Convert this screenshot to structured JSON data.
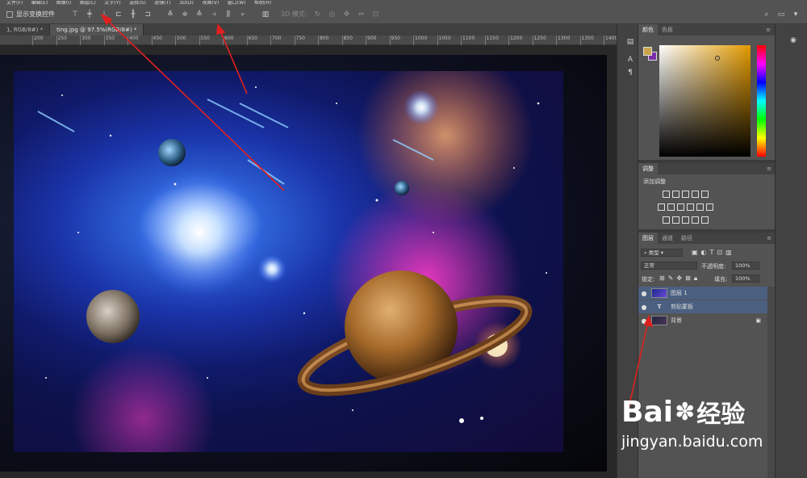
{
  "menubar": {
    "items": [
      "文件(F)",
      "编辑(E)",
      "图像(I)",
      "图层(L)",
      "文字(Y)",
      "选择(S)",
      "滤镜(T)",
      "3D(D)",
      "视图(V)",
      "窗口(W)",
      "帮助(H)"
    ]
  },
  "options": {
    "show_transform_label": "显示变换控件",
    "mode_3d_label": "3D 模式:"
  },
  "tabs": [
    {
      "label": "1, RGB/8#) *",
      "active": false
    },
    {
      "label": "ting.jpg @ 97.5%(RGB/8#) *",
      "active": true
    }
  ],
  "ruler": {
    "ticks": [
      "200",
      "250",
      "300",
      "350",
      "400",
      "450",
      "500",
      "550",
      "600",
      "650",
      "700",
      "750",
      "800",
      "850",
      "900",
      "950",
      "1000",
      "1050",
      "1100",
      "1150",
      "1200",
      "1250",
      "1300",
      "1350",
      "1400"
    ]
  },
  "color_panel": {
    "tab_active": "颜色",
    "tab_other": "色板",
    "foreground": "#c9a44a",
    "background": "#7b2fa8"
  },
  "adjust_panel": {
    "title": "调整",
    "add_label": "添加调整"
  },
  "layers_panel": {
    "tabs": [
      "图层",
      "通道",
      "路径"
    ],
    "filter_label": "类型",
    "blend_mode": "正常",
    "opacity_label": "不透明度:",
    "opacity_value": "100%",
    "lock_label": "锁定:",
    "fill_label": "填充:",
    "fill_value": "100%",
    "layers": [
      {
        "name": "图层 1",
        "selected": true
      },
      {
        "name": "剪贴蒙板",
        "selected": true
      },
      {
        "name": "背景",
        "selected": false
      }
    ]
  },
  "watermark": {
    "brand": "Bai",
    "brand_cn": "经验",
    "url": "jingyan.baidu.com"
  }
}
